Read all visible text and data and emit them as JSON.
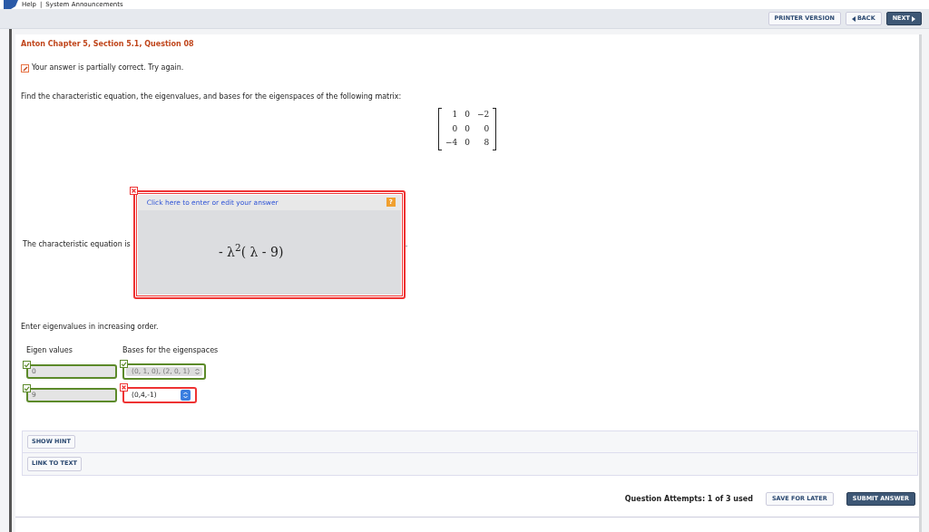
{
  "header": {
    "links": [
      "Help",
      "System Announcements"
    ],
    "separator": "|"
  },
  "toolbar": {
    "buttons": [
      {
        "label": "PRINTER VERSION",
        "kind": "plain"
      },
      {
        "label": "BACK",
        "kind": "back"
      },
      {
        "label": "NEXT",
        "kind": "next"
      }
    ]
  },
  "question": {
    "title": "Anton Chapter 5, Section 5.1, Question 08",
    "feedback": {
      "kind": "partial",
      "text": "Your answer is partially correct.  Try again."
    },
    "prompt": "Find the characteristic equation, the eigenvalues, and bases for the eigenspaces of the following matrix:",
    "matrix": [
      [
        "1",
        "0",
        "−2"
      ],
      [
        "0",
        "0",
        "0"
      ],
      [
        "−4",
        "0",
        "8"
      ]
    ]
  },
  "equation": {
    "label": "The characteristic equation is",
    "trailing": ".",
    "answer_box": {
      "correct": false,
      "edit_link": "Click here to enter or edit your answer",
      "help_label": "?",
      "expression": "-  λ$^{2}$( λ - 9)"
    }
  },
  "eigen": {
    "instruction": "Enter eigenvalues in increasing order.",
    "columns": [
      "Eigen values",
      "Bases for the eigenspaces"
    ],
    "rows": [
      {
        "value": "0",
        "value_correct": true,
        "value_disabled": true,
        "basis": "(0, 1, 0), (2, 0, 1)",
        "basis_correct": true,
        "basis_disabled": true
      },
      {
        "value": "9",
        "value_correct": true,
        "value_disabled": true,
        "basis": "(0,4,-1)",
        "basis_correct": false,
        "basis_disabled": false
      }
    ]
  },
  "tools": [
    "SHOW HINT",
    "LINK TO TEXT"
  ],
  "footer": {
    "attempts": "Question Attempts: 1 of 3 used",
    "buttons": [
      {
        "label": "SAVE FOR LATER",
        "kind": "plain"
      },
      {
        "label": "SUBMIT ANSWER",
        "kind": "primary"
      }
    ]
  }
}
